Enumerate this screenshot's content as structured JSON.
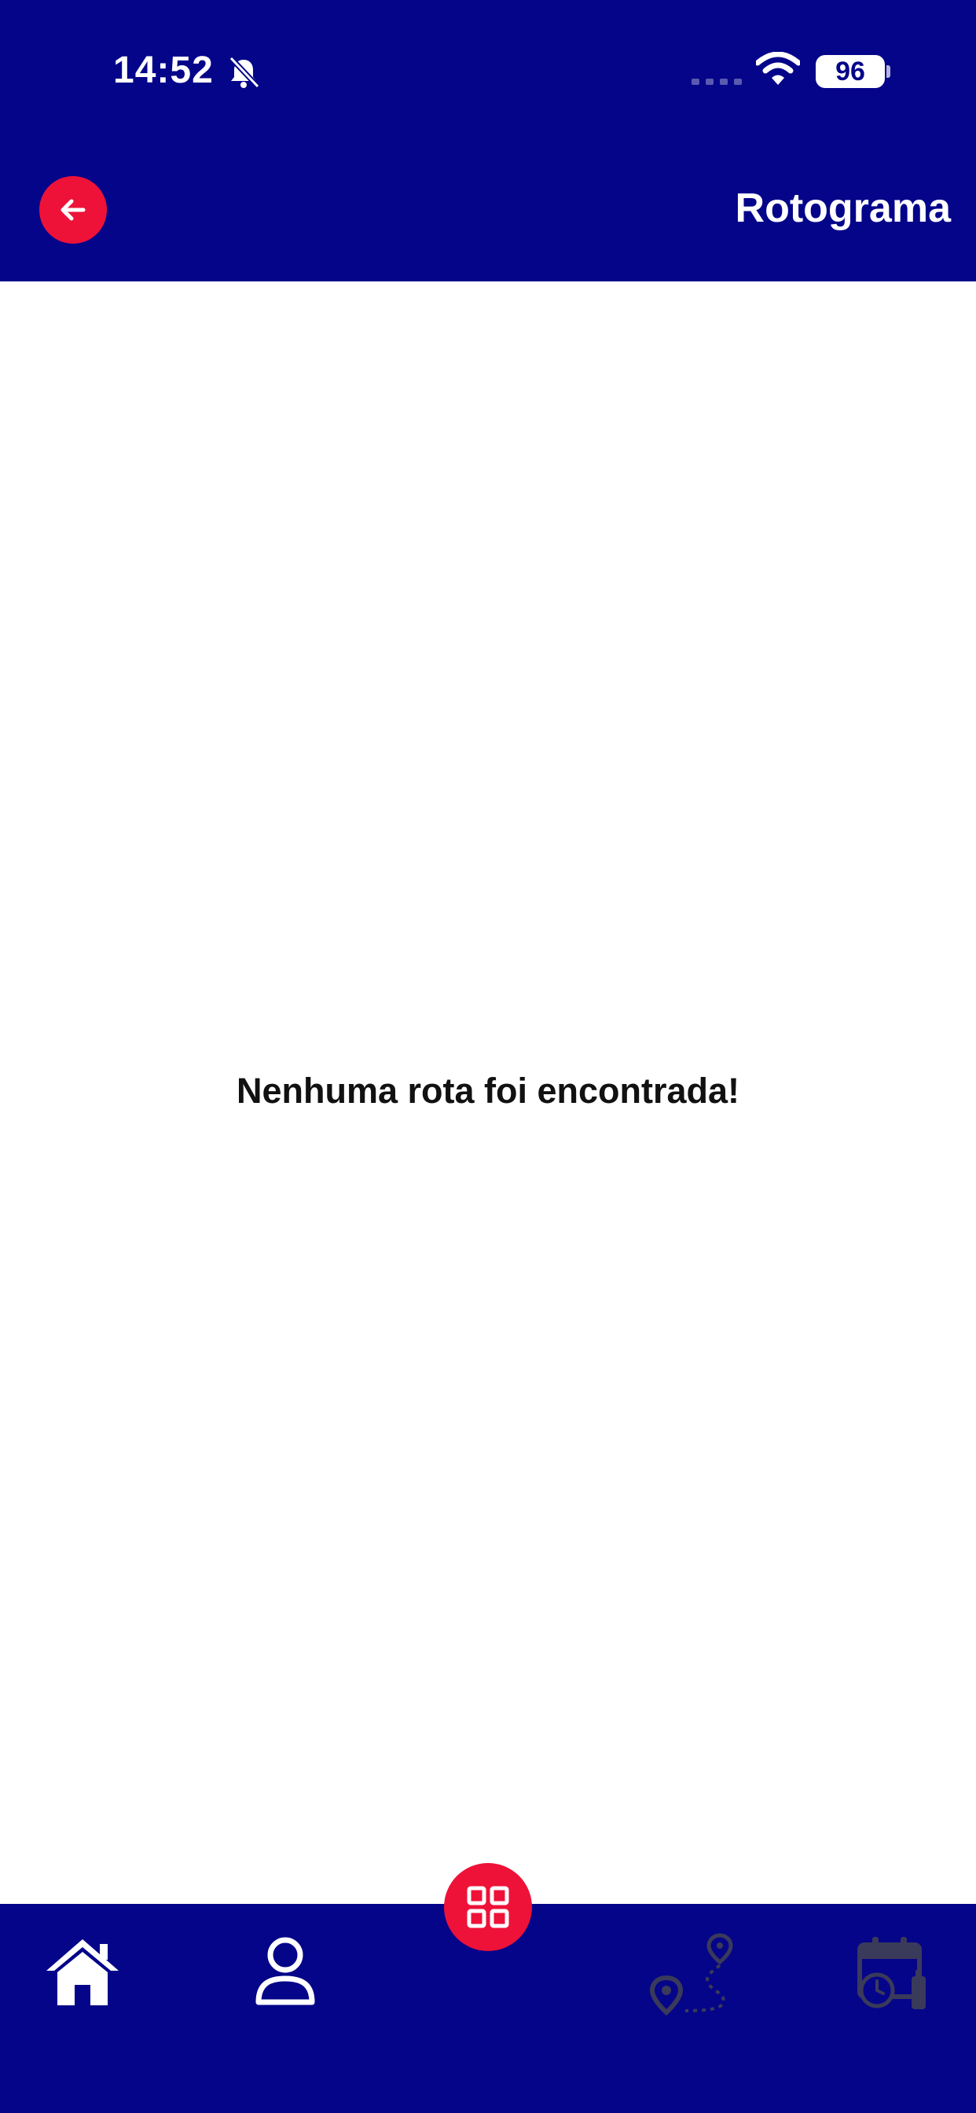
{
  "status_bar": {
    "time": "14:52",
    "battery": "96"
  },
  "header": {
    "title": "Rotograma"
  },
  "main": {
    "empty_message": "Nenhuma rota foi encontrada!"
  },
  "colors": {
    "primary": "#05058a",
    "accent": "#ee1238",
    "background": "#ffffff",
    "disabled_icon": "#3a3a5a"
  },
  "icons": {
    "back": "arrow-left-icon",
    "fab": "grid-icon",
    "home": "home-icon",
    "profile": "user-icon",
    "route": "route-map-icon",
    "calendar": "calendar-clock-icon"
  }
}
